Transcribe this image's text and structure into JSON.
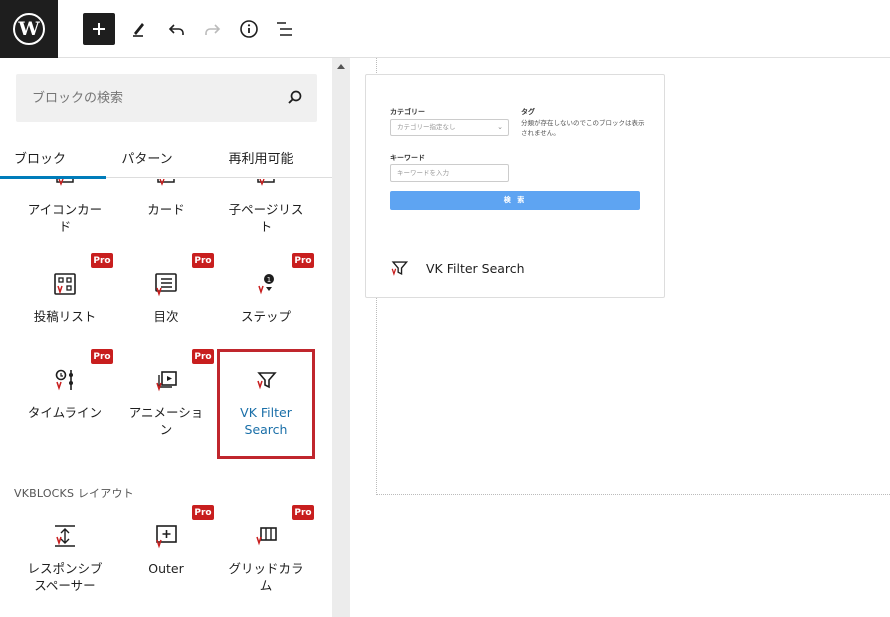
{
  "app": {
    "logo": "wordpress-logo"
  },
  "toolbar": {
    "add_label": "+",
    "icons": [
      "plus-icon",
      "pencil-icon",
      "undo-icon",
      "redo-icon",
      "info-icon",
      "list-view-icon"
    ]
  },
  "inserter": {
    "search_placeholder": "ブロックの検索",
    "tabs": [
      "ブロック",
      "パターン",
      "再利用可能"
    ],
    "active_tab": "ブロック",
    "partial_row": [
      "アイコンカード",
      "カード",
      "子ページリスト"
    ],
    "pro_badge": "Pro",
    "rows": [
      [
        {
          "label": "投稿リスト",
          "pro": true,
          "icon": "post-list-icon"
        },
        {
          "label": "目次",
          "pro": true,
          "icon": "table-of-contents-icon"
        },
        {
          "label": "ステップ",
          "pro": true,
          "icon": "step-icon"
        }
      ],
      [
        {
          "label": "タイムライン",
          "pro": true,
          "icon": "timeline-icon"
        },
        {
          "label": "アニメーション",
          "pro": true,
          "icon": "animation-icon"
        },
        {
          "label": "VK Filter Search",
          "pro": false,
          "icon": "filter-icon",
          "selected": true
        }
      ]
    ],
    "section_title": "VKBLOCKS レイアウト",
    "layout_row": [
      {
        "label": "レスポンシブスペーサー",
        "pro": false,
        "icon": "spacer-icon"
      },
      {
        "label": "Outer",
        "pro": true,
        "icon": "outer-icon"
      },
      {
        "label": "グリッドカラム",
        "pro": true,
        "icon": "grid-column-icon"
      }
    ]
  },
  "preview": {
    "category_label": "カテゴリー",
    "category_select": "カテゴリー指定なし",
    "tag_label": "タグ",
    "tag_note": "分類が存在しないのでこのブロックは表示されません。",
    "keyword_label": "キーワード",
    "keyword_placeholder": "キーワードを入力",
    "search_button": "検 索",
    "block_title": "VK Filter Search"
  },
  "colors": {
    "accent": "#007cba",
    "pro_badge": "#c81e1e",
    "selection": "#c0262d",
    "preview_button": "#5ea4f2"
  }
}
